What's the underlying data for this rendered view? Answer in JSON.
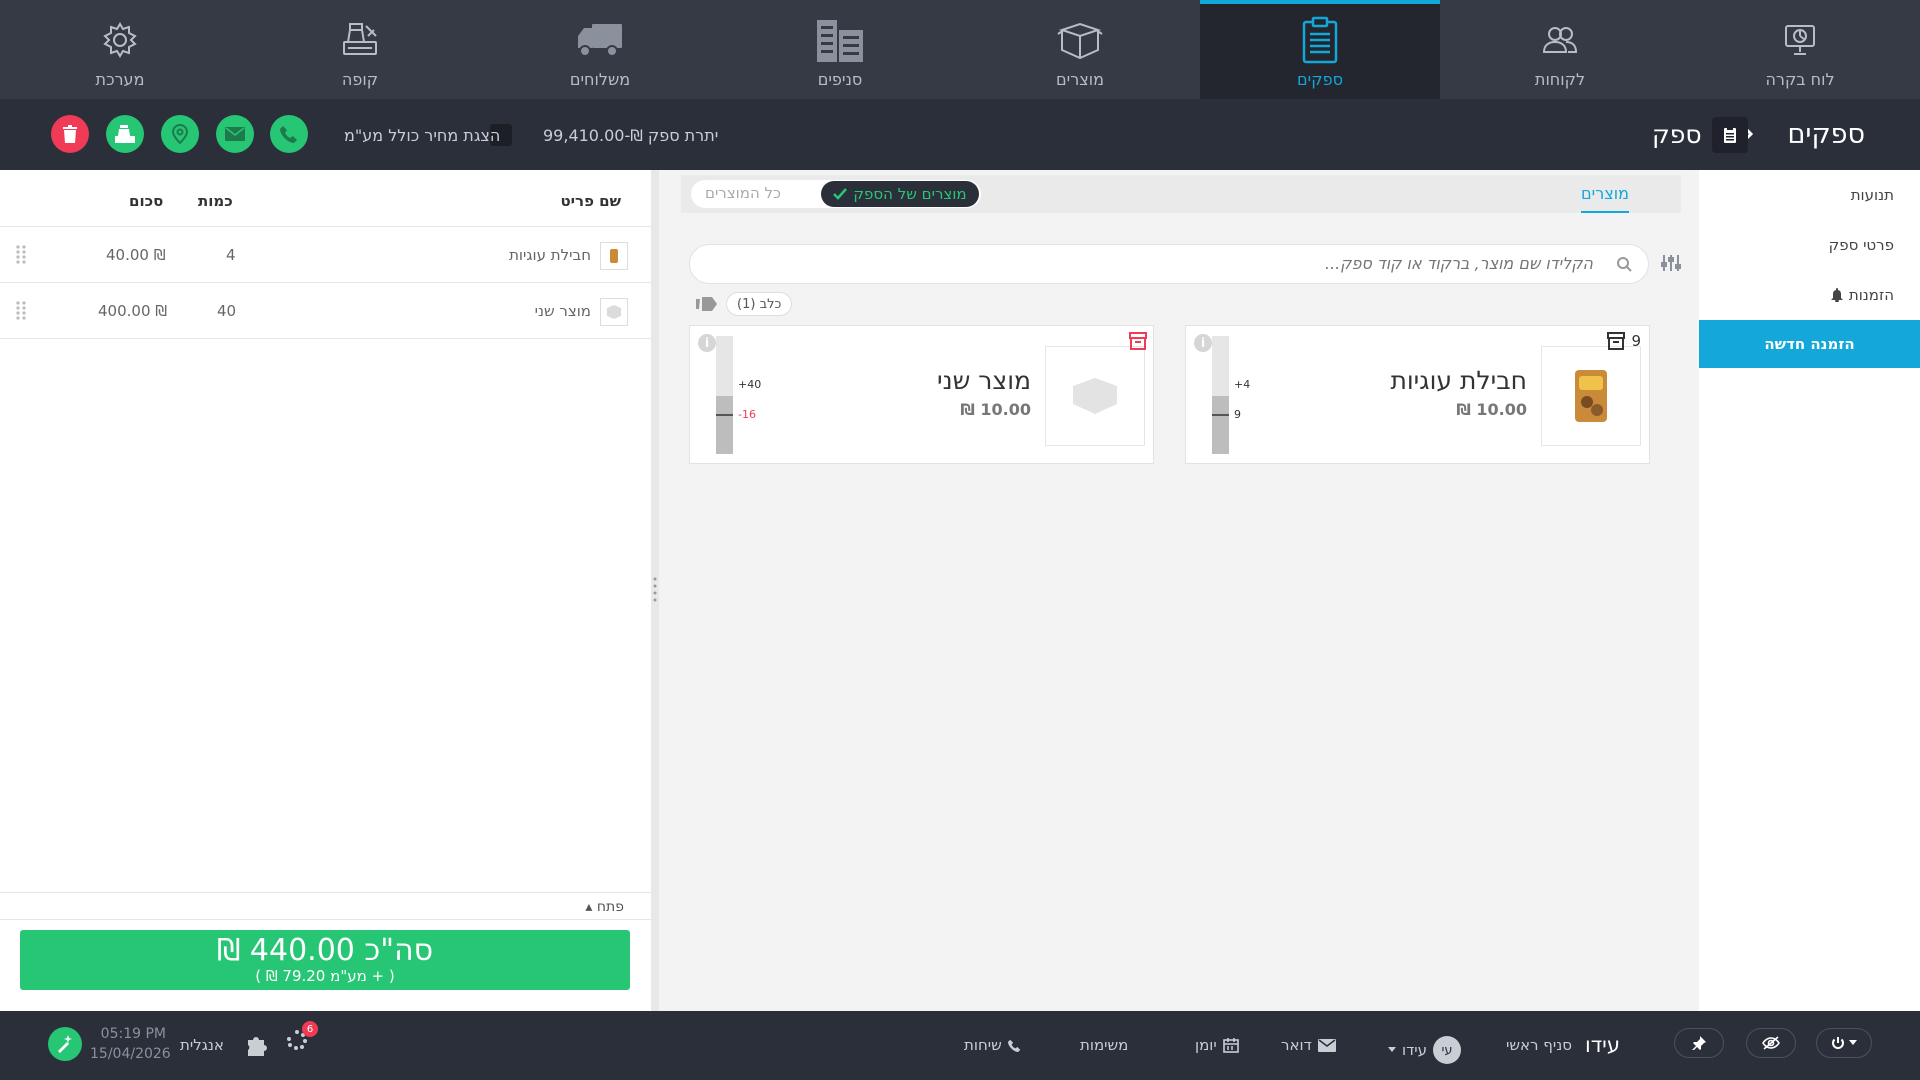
{
  "topnav": {
    "items": [
      {
        "label": "לוח בקרה",
        "icon": "dashboard-icon"
      },
      {
        "label": "לקוחות",
        "icon": "customers-icon"
      },
      {
        "label": "ספקים",
        "icon": "suppliers-clipboard-icon",
        "active": true
      },
      {
        "label": "מוצרים",
        "icon": "products-box-icon"
      },
      {
        "label": "סניפים",
        "icon": "branches-building-icon"
      },
      {
        "label": "משלוחים",
        "icon": "delivery-truck-icon"
      },
      {
        "label": "קופה",
        "icon": "register-icon"
      },
      {
        "label": "מערכת",
        "icon": "gear-icon"
      }
    ],
    "active_color": "#13a7da"
  },
  "header": {
    "breadcrumb_main": "ספקים",
    "breadcrumb_sub": "ספק",
    "balance": "יתרת ספק ₪-99,410.00",
    "vat_label": "הצגת מחיר כולל מע\"מ"
  },
  "cart": {
    "columns": {
      "name": "שם פריט",
      "qty": "כמות",
      "total": "סכום"
    },
    "rows": [
      {
        "name": "חבילת עוגיות",
        "qty": "4",
        "total": "40.00 ₪"
      },
      {
        "name": "מוצר שני",
        "qty": "40",
        "total": "400.00 ₪"
      }
    ],
    "open_label": "פתח",
    "total_label": "סה\"כ 440.00 ₪",
    "vat_label": "( + מע\"מ 79.20 ₪ )",
    "total_color": "#26c674"
  },
  "main": {
    "tab_products": "מוצרים",
    "filter_supplier": "מוצרים של הספק",
    "filter_all": "כל המוצרים",
    "search_placeholder": "הקלידו שם מוצר, ברקוד או קוד ספק...",
    "tag_chip": "כלב (1)",
    "products": [
      {
        "name": "חבילת עוגיות",
        "price": "10.00 ₪",
        "stock": "9",
        "ordered": "+4",
        "on_hand": "9"
      },
      {
        "name": "מוצר שני",
        "price": "10.00 ₪",
        "ordered": "+40",
        "on_hand": "-16"
      }
    ]
  },
  "side": {
    "items": [
      "תנועות",
      "פרטי ספק",
      "הזמנות"
    ],
    "new_order": "הזמנה חדשה"
  },
  "footer": {
    "user": "עידו",
    "branch": "סניף ראשי",
    "user_small": "עידו",
    "avatar": "עי",
    "mail": "דואר",
    "diary": "יומן",
    "tasks": "משימות",
    "calls": "שיחות",
    "language": "אנגלית",
    "time": "05:19 PM",
    "date": "15/04/2026",
    "notif_count": "6"
  }
}
